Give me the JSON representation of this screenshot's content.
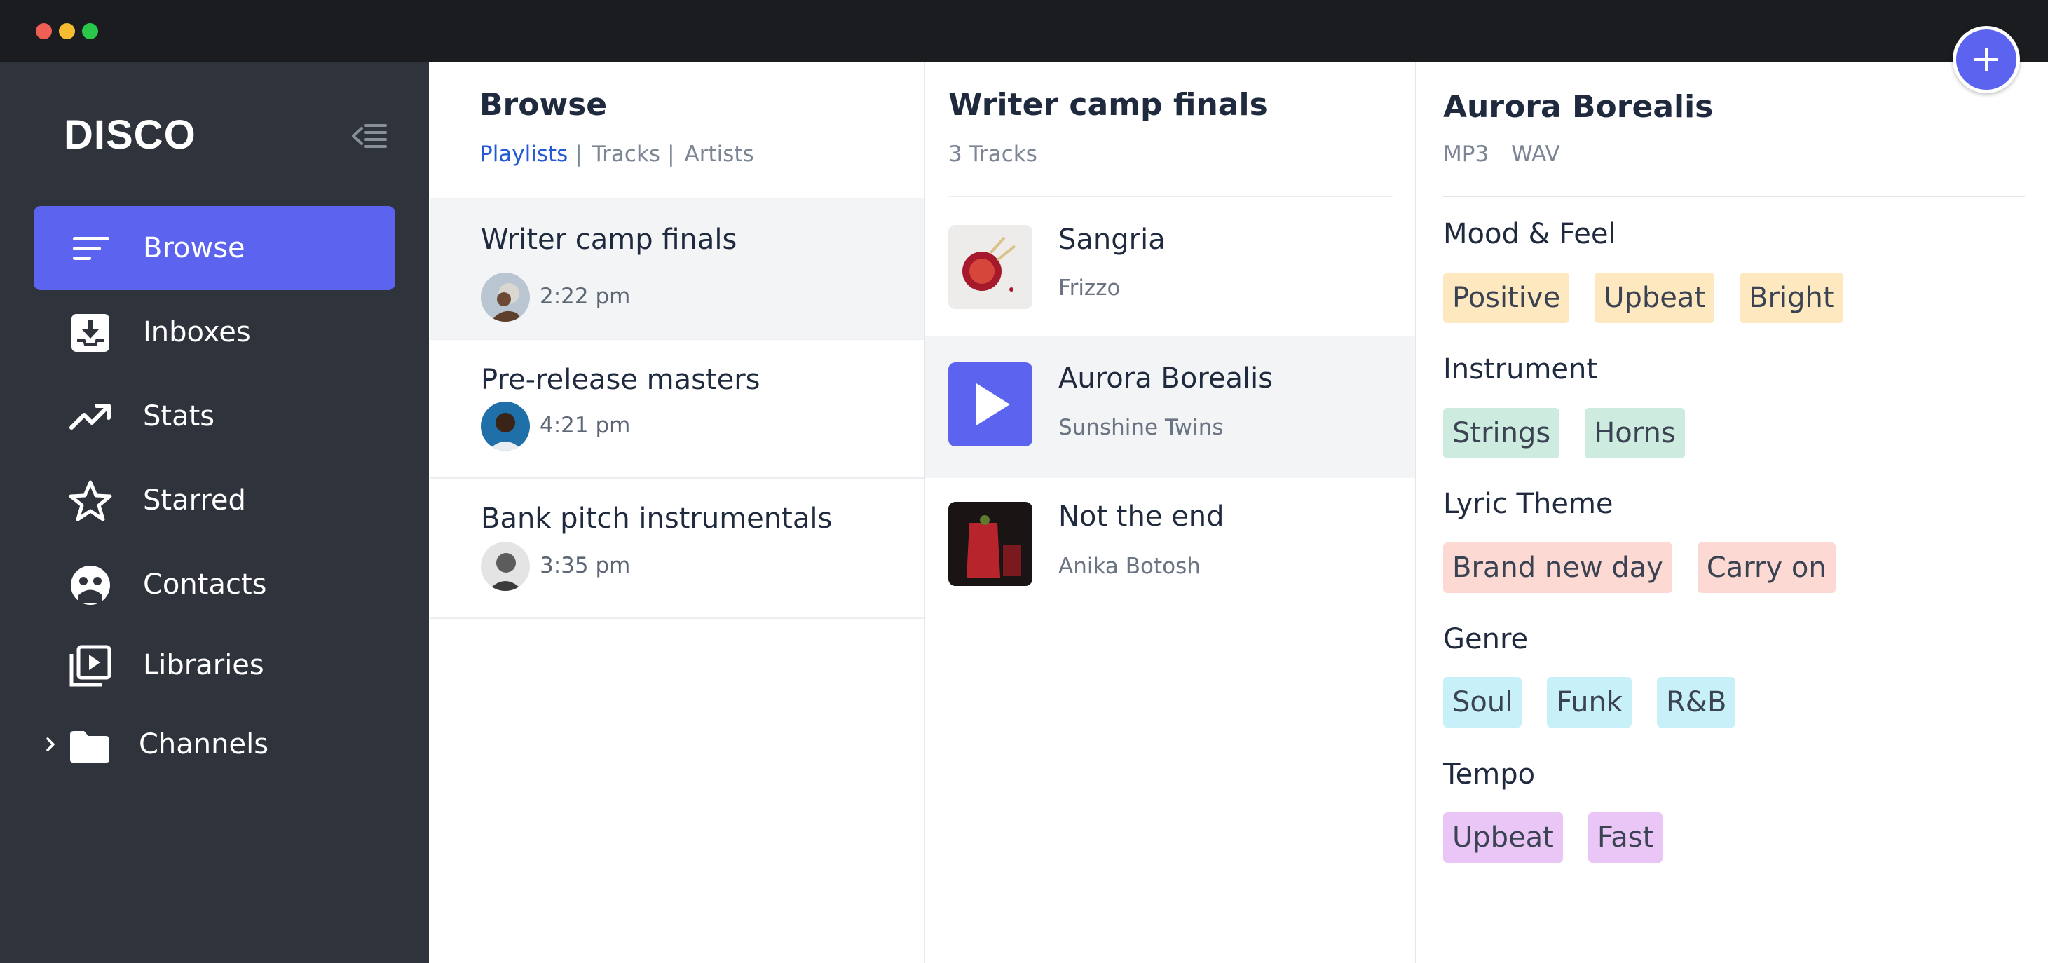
{
  "window": {
    "controls": [
      "close",
      "minimize",
      "maximize"
    ]
  },
  "sidebar": {
    "logo": "DISCO",
    "collapse_icon": "collapse-sidebar-icon",
    "items": [
      {
        "label": "Browse",
        "icon": "browse-lines-icon",
        "active": true
      },
      {
        "label": "Inboxes",
        "icon": "inbox-download-icon",
        "active": false
      },
      {
        "label": "Stats",
        "icon": "trending-up-icon",
        "active": false
      },
      {
        "label": "Starred",
        "icon": "star-icon",
        "active": false
      },
      {
        "label": "Contacts",
        "icon": "contacts-face-icon",
        "active": false
      },
      {
        "label": "Libraries",
        "icon": "library-play-icon",
        "active": false
      }
    ],
    "channels": {
      "label": "Channels",
      "icon": "folder-icon",
      "expand_icon": "chevron-right-icon"
    }
  },
  "browse": {
    "title": "Browse",
    "tabs": [
      {
        "label": "Playlists",
        "separator": "|"
      },
      {
        "label": "Tracks",
        "separator": "|"
      },
      {
        "label": "Artists",
        "separator": ""
      }
    ],
    "active_tab": "Playlists",
    "playlists": [
      {
        "title": "Writer camp finals",
        "time": "2:22 pm",
        "selected": true
      },
      {
        "title": "Pre-release masters",
        "time": "4:21 pm",
        "selected": false
      },
      {
        "title": "Bank pitch instrumentals",
        "time": "3:35 pm",
        "selected": false
      }
    ]
  },
  "playlist": {
    "title": "Writer camp finals",
    "count": "3 Tracks",
    "tracks": [
      {
        "title": "Sangria",
        "artist": "Frizzo",
        "selected": false
      },
      {
        "title": "Aurora Borealis",
        "artist": "Sunshine Twins",
        "selected": true,
        "icon": "play-icon"
      },
      {
        "title": "Not the end",
        "artist": "Anika Botosh",
        "selected": false
      }
    ]
  },
  "track_detail": {
    "title": "Aurora Borealis",
    "formats": [
      "MP3",
      "WAV"
    ],
    "categories": [
      {
        "label": "Mood & Feel",
        "tags": [
          "Positive",
          "Upbeat",
          "Bright"
        ],
        "color": "#fde8bf"
      },
      {
        "label": "Instrument",
        "tags": [
          "Strings",
          "Horns"
        ],
        "color": "#cdebdf"
      },
      {
        "label": "Lyric Theme",
        "tags": [
          "Brand new day",
          "Carry on"
        ],
        "color": "#fcd9d3"
      },
      {
        "label": "Genre",
        "tags": [
          "Soul",
          "Funk",
          "R&B"
        ],
        "color": "#c7f0f9"
      },
      {
        "label": "Tempo",
        "tags": [
          "Upbeat",
          "Fast"
        ],
        "color": "#eac6f6"
      }
    ]
  },
  "fab": {
    "symbol": "+",
    "icon": "plus-icon"
  },
  "colors": {
    "accent": "#5b63ef",
    "sidebar_bg": "#2f333c",
    "titlebar_bg": "#1b1c20",
    "link": "#2459d6"
  }
}
